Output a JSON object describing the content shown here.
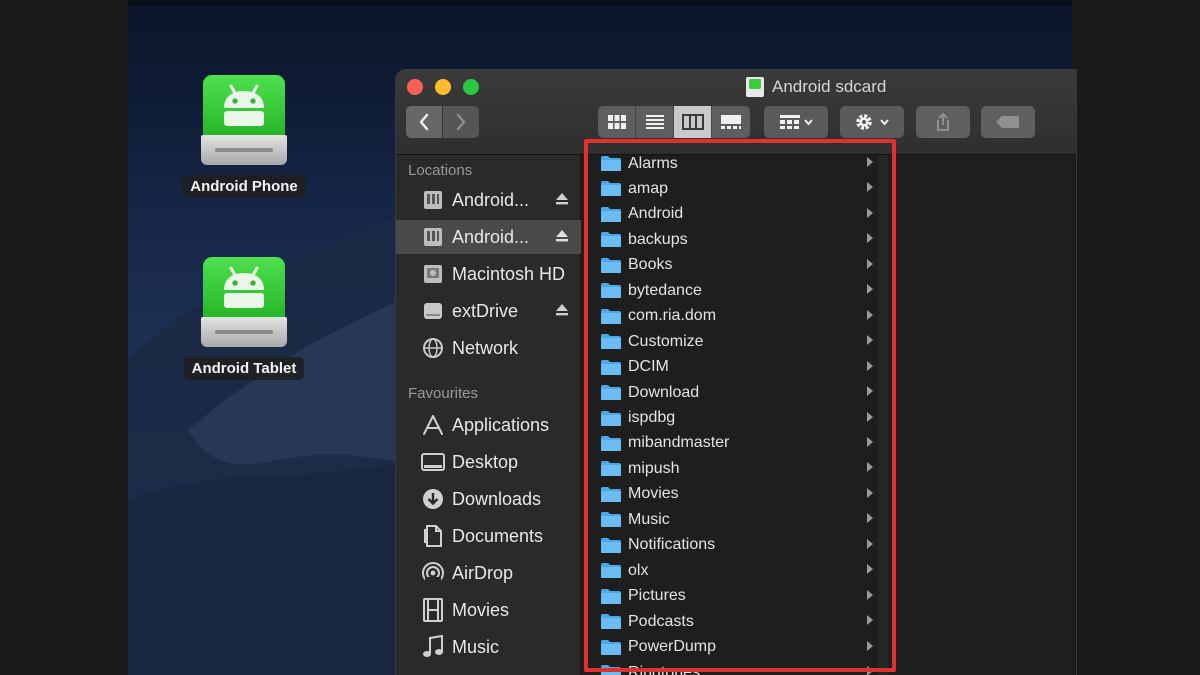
{
  "desktop": {
    "icons": [
      {
        "label": "Android Phone"
      },
      {
        "label": "Android Tablet"
      }
    ]
  },
  "window": {
    "title": "Android sdcard",
    "toolbar": {
      "back_icon": "chevron-left-icon",
      "forward_icon": "chevron-right-icon",
      "views": [
        "icon-view-icon",
        "list-view-icon",
        "column-view-icon",
        "gallery-view-icon"
      ],
      "active_view": "column"
    },
    "sidebar": {
      "locations_heading": "Locations",
      "locations": [
        {
          "label": "Android...",
          "icon": "drive-icon",
          "eject": true
        },
        {
          "label": "Android...",
          "icon": "drive-icon",
          "eject": true,
          "selected": true
        },
        {
          "label": "Macintosh HD",
          "icon": "hard-disk-icon",
          "eject": false
        },
        {
          "label": "extDrive",
          "icon": "external-drive-icon",
          "eject": true
        },
        {
          "label": "Network",
          "icon": "globe-icon",
          "eject": false
        }
      ],
      "favourites_heading": "Favourites",
      "favourites": [
        {
          "label": "Applications",
          "icon": "applications-icon"
        },
        {
          "label": "Desktop",
          "icon": "desktop-icon"
        },
        {
          "label": "Downloads",
          "icon": "download-icon"
        },
        {
          "label": "Documents",
          "icon": "document-icon"
        },
        {
          "label": "AirDrop",
          "icon": "airdrop-icon"
        },
        {
          "label": "Movies",
          "icon": "film-icon"
        },
        {
          "label": "Music",
          "icon": "music-note-icon"
        }
      ]
    },
    "folders": [
      "Alarms",
      "amap",
      "Android",
      "backups",
      "Books",
      "bytedance",
      "com.ria.dom",
      "Customize",
      "DCIM",
      "Download",
      "ispdbg",
      "mibandmaster",
      "mipush",
      "Movies",
      "Music",
      "Notifications",
      "olx",
      "Pictures",
      "Podcasts",
      "PowerDump",
      "Ringtones"
    ]
  },
  "colors": {
    "highlight": "#e0312f",
    "folder": "#4aa8e8",
    "android_green": "#3ccb3c"
  }
}
